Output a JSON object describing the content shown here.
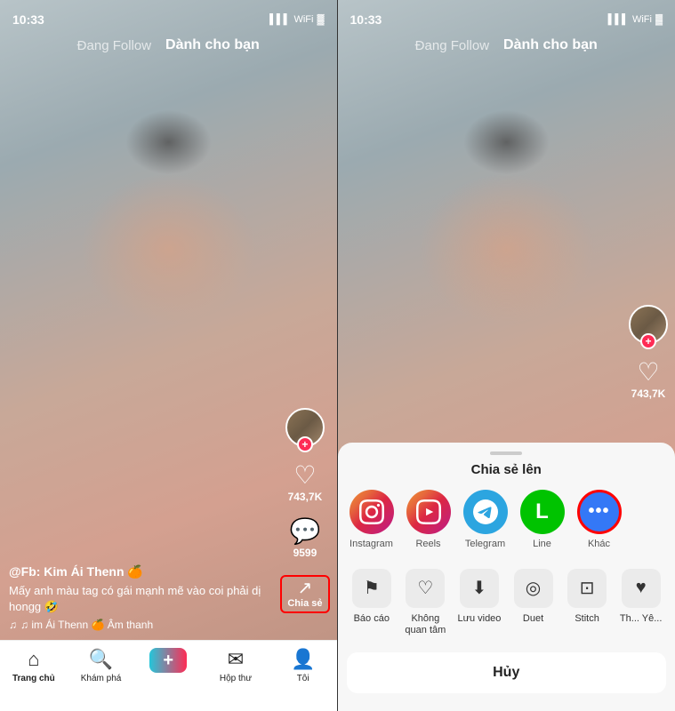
{
  "left_phone": {
    "status": {
      "time": "10:33",
      "signal": "▌▌▌",
      "wifi": "WiFi",
      "battery": "🔋"
    },
    "nav": {
      "following": "Đang Follow",
      "for_you": "Dành cho bạn"
    },
    "sidebar": {
      "likes": "743,7K",
      "comments": "9599",
      "share_label": "Chia sẻ"
    },
    "content": {
      "username": "@Fb: Kim Ái Thenn 🍊",
      "caption": "Mấy anh màu tag có gái mạnh mẽ vào coi phải dị hongg 🤣",
      "sound": "♫ im Ái Thenn 🍊 Âm thanh"
    },
    "bottom_nav": {
      "tabs": [
        {
          "label": "Trang chủ",
          "icon": "⌂",
          "active": true
        },
        {
          "label": "Khám phá",
          "icon": "⊕"
        },
        {
          "label": "",
          "icon": "+"
        },
        {
          "label": "Hộp thư",
          "icon": "☐"
        },
        {
          "label": "Tôi",
          "icon": "○"
        }
      ]
    }
  },
  "right_phone": {
    "status": {
      "time": "10:33"
    },
    "nav": {
      "following": "Đang Follow",
      "for_you": "Dành cho bạn"
    },
    "sidebar": {
      "likes": "743,7K"
    },
    "share_sheet": {
      "title": "Chia sẻ lên",
      "apps": [
        {
          "name": "Instagram",
          "icon": "📷",
          "style": "instagram"
        },
        {
          "name": "Reels",
          "icon": "🎬",
          "style": "reels"
        },
        {
          "name": "Telegram",
          "icon": "✈",
          "style": "telegram"
        },
        {
          "name": "Line",
          "icon": "💬",
          "style": "line"
        },
        {
          "name": "Khác",
          "icon": "···",
          "style": "khac",
          "highlighted": true
        }
      ],
      "actions": [
        {
          "label": "Báo cáo",
          "icon": "⚑"
        },
        {
          "label": "Không quan tâm",
          "icon": "♡"
        },
        {
          "label": "Lưu video",
          "icon": "⬇"
        },
        {
          "label": "Duet",
          "icon": "◎"
        },
        {
          "label": "Stitch",
          "icon": "⊡"
        },
        {
          "label": "Th... Yê...",
          "icon": "♥"
        }
      ],
      "cancel": "Hủy"
    }
  }
}
